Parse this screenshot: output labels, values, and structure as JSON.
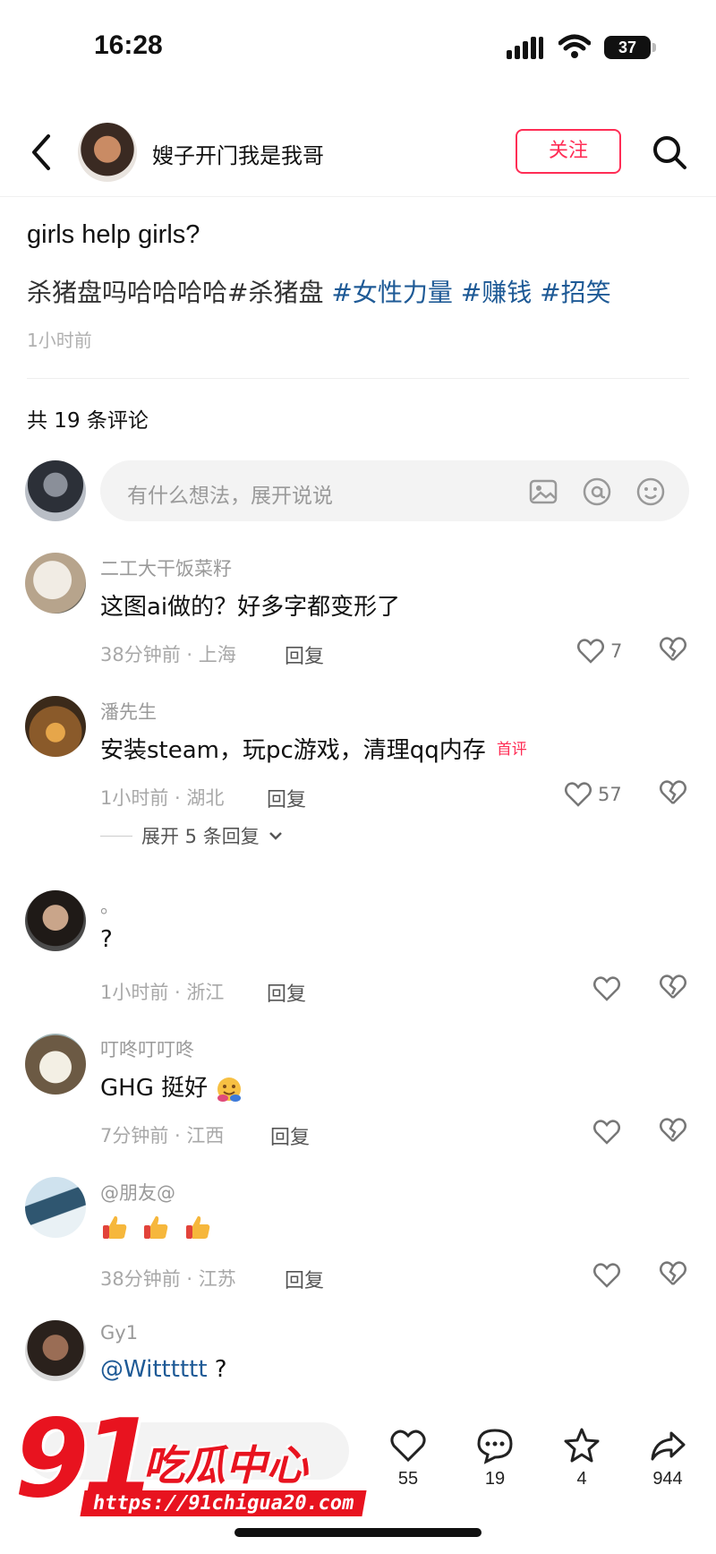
{
  "status_bar": {
    "time": "16:28",
    "battery": "37"
  },
  "header": {
    "author_name": "嫂子开门我是我哥",
    "follow_label": "关注"
  },
  "post": {
    "title": "girls help girls?",
    "body_plain": "杀猪盘吗哈哈哈哈#杀猪盘 ",
    "tags": [
      "#女性力量",
      "#赚钱",
      "#招笑"
    ],
    "time": "1小时前"
  },
  "comments_header": "共 19 条评论",
  "input": {
    "placeholder": "有什么想法，展开说说"
  },
  "comments": [
    {
      "name": "二工大干饭菜籽",
      "text": "这图ai做的？好多字都变形了",
      "meta": "38分钟前 · 上海",
      "reply": "回复",
      "likes": "7"
    },
    {
      "name": "潘先生",
      "text": "安装steam，玩pc游戏，清理qq内存",
      "badge": "首评",
      "meta": "1小时前 · 湖北",
      "reply": "回复",
      "likes": "57",
      "expand": "展开 5 条回复"
    },
    {
      "name": "。",
      "text": "?",
      "meta": "1小时前 · 浙江",
      "reply": "回复",
      "likes": ""
    },
    {
      "name": "叮咚叮叮咚",
      "text": "GHG 挺好",
      "meta": "7分钟前 · 江西",
      "reply": "回复",
      "likes": ""
    },
    {
      "name": "@朋友@",
      "text": "",
      "meta": "38分钟前 · 江苏",
      "reply": "回复",
      "likes": ""
    },
    {
      "name": "Gy1",
      "mention": "@Witttttt",
      "text_after": " ?",
      "likes": ""
    }
  ],
  "bottom_bar": {
    "likes": "55",
    "comments": "19",
    "stars": "4",
    "shares": "944"
  },
  "watermark": {
    "number": "91",
    "name": "吃瓜中心",
    "url": "https://91chigua20.com"
  },
  "colors": {
    "accent": "#ff2d55",
    "tag": "#1e5a96",
    "watermark": "#e8131f"
  }
}
